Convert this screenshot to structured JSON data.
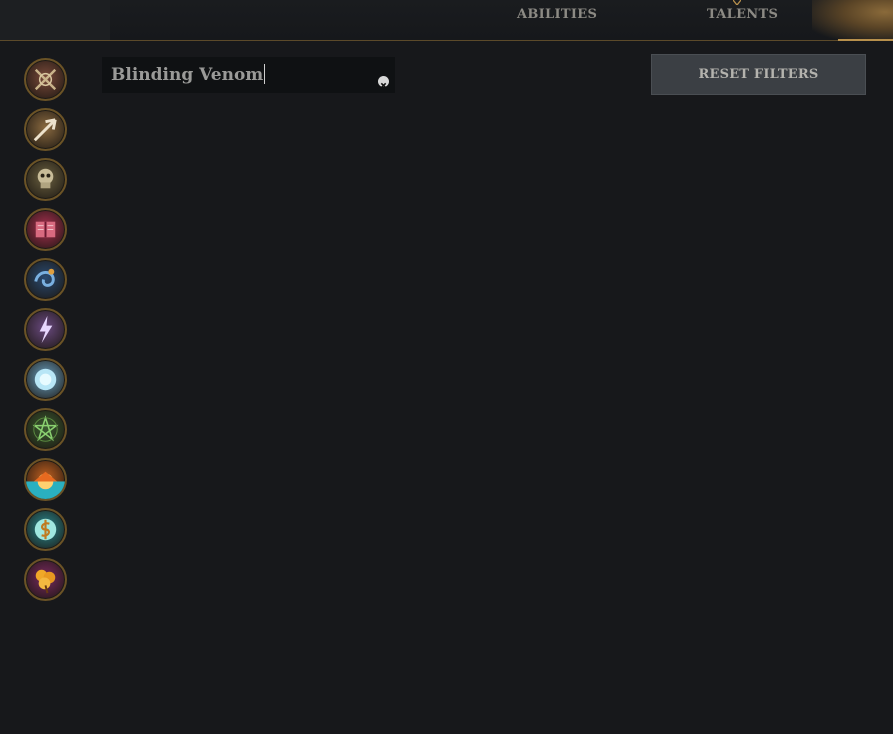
{
  "tabs": {
    "abilities_label": "ABILITIES",
    "talents_label": "TALENTS"
  },
  "search": {
    "value": "Blinding Venom"
  },
  "reset_button": {
    "label": "RESET FILTERS"
  },
  "filters": [
    {
      "icon": "crossed-bow-icon",
      "color": "#7a4a3a"
    },
    {
      "icon": "arrow-icon",
      "color": "#8a6a40"
    },
    {
      "icon": "skull-icon",
      "color": "#6a6040"
    },
    {
      "icon": "spellbook-icon",
      "color": "#a83050"
    },
    {
      "icon": "water-swirl-icon",
      "color": "#2a4a70"
    },
    {
      "icon": "lightning-icon",
      "color": "#6a4a80"
    },
    {
      "icon": "frost-orb-icon",
      "color": "#6aa0c0"
    },
    {
      "icon": "pentagram-icon",
      "color": "#3a5a30"
    },
    {
      "icon": "sunset-icon",
      "color": "#c06020"
    },
    {
      "icon": "coin-rune-icon",
      "color": "#2a8a90"
    },
    {
      "icon": "golden-flower-icon",
      "color": "#7a2a60"
    }
  ],
  "colors": {
    "background": "#17181b",
    "accent_gold": "#b8904c",
    "button_bg": "#3b3f44"
  }
}
